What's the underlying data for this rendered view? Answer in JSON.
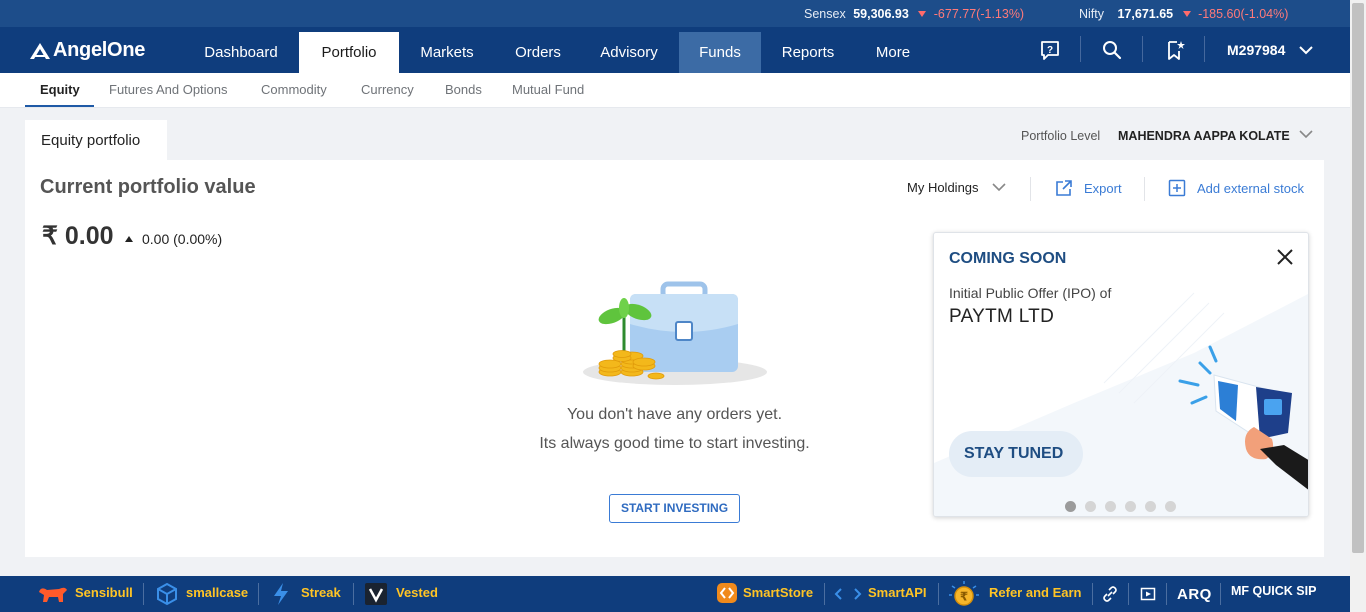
{
  "ticker": {
    "sensex": {
      "label": "Sensex",
      "value": "59,306.93",
      "change": "-677.77(-1.13%)"
    },
    "nifty": {
      "label": "Nifty",
      "value": "17,671.65",
      "change": "-185.60(-1.04%)"
    }
  },
  "nav": {
    "logo": "AngelOne",
    "items": [
      "Dashboard",
      "Portfolio",
      "Markets",
      "Orders",
      "Advisory",
      "Funds",
      "Reports",
      "More"
    ],
    "active": "Portfolio",
    "user": "M297984"
  },
  "subnav": {
    "tabs": [
      "Equity",
      "Futures And Options",
      "Commodity",
      "Currency",
      "Bonds",
      "Mutual Fund"
    ],
    "active": "Equity"
  },
  "portfolio": {
    "tab": "Equity portfolio",
    "level_label": "Portfolio Level",
    "level_value": "MAHENDRA AAPPA KOLATE",
    "title": "Current portfolio value",
    "amount": "₹ 0.00",
    "change": "0.00 (0.00%)",
    "holdings": "My Holdings",
    "export": "Export",
    "add_external": "Add external stock",
    "empty_line1": "You don't have any orders yet.",
    "empty_line2": "Its always good time to start investing.",
    "start_button": "START INVESTING"
  },
  "promo": {
    "heading": "COMING SOON",
    "line": "Initial Public Offer (IPO) of",
    "company": "PAYTM LTD",
    "cta": "STAY TUNED",
    "slides": 6,
    "current_slide": 1
  },
  "footer": {
    "left": [
      "Sensibull",
      "smallcase",
      "Streak",
      "Vested"
    ],
    "right": [
      "SmartStore",
      "SmartAPI",
      "Refer and Earn"
    ],
    "brand": "ARQ",
    "sip": "MF QUICK SIP"
  },
  "colors": {
    "nav": "#0f3d7d",
    "accent": "#3a7bd5",
    "footer_text": "#ffc425",
    "negative": "#ff7a7a"
  }
}
